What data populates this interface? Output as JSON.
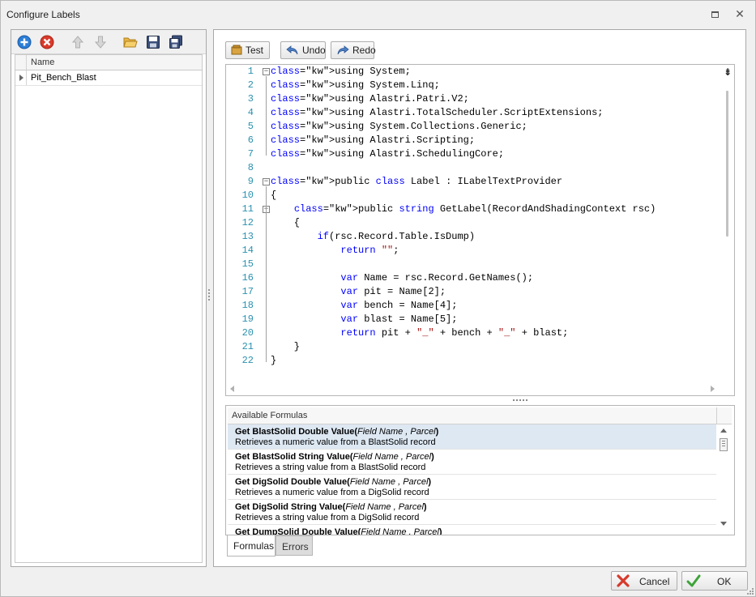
{
  "window": {
    "title": "Configure Labels"
  },
  "left_panel": {
    "toolbar_icons": [
      "add-icon",
      "delete-icon",
      "move-up-icon",
      "move-down-icon",
      "open-folder-icon",
      "save-icon",
      "save-all-icon"
    ],
    "grid": {
      "column_header": "Name",
      "rows": [
        "Pit_Bench_Blast"
      ]
    }
  },
  "editor_toolbar": {
    "test_label": "Test",
    "undo_label": "Undo",
    "redo_label": "Redo"
  },
  "code_lines": [
    {
      "n": "1",
      "text": "using System;"
    },
    {
      "n": "2",
      "text": "using System.Linq;"
    },
    {
      "n": "3",
      "text": "using Alastri.Patri.V2;"
    },
    {
      "n": "4",
      "text": "using Alastri.TotalScheduler.ScriptExtensions;"
    },
    {
      "n": "5",
      "text": "using System.Collections.Generic;"
    },
    {
      "n": "6",
      "text": "using Alastri.Scripting;"
    },
    {
      "n": "7",
      "text": "using Alastri.SchedulingCore;"
    },
    {
      "n": "8",
      "text": ""
    },
    {
      "n": "9",
      "text": "public class Label : ILabelTextProvider"
    },
    {
      "n": "10",
      "text": "{"
    },
    {
      "n": "11",
      "text": "    public string GetLabel(RecordAndShadingContext rsc)"
    },
    {
      "n": "12",
      "text": "    {"
    },
    {
      "n": "13",
      "text": "        if(rsc.Record.Table.IsDump)"
    },
    {
      "n": "14",
      "text": "            return \"\";"
    },
    {
      "n": "15",
      "text": ""
    },
    {
      "n": "16",
      "text": "            var Name = rsc.Record.GetNames();"
    },
    {
      "n": "17",
      "text": "            var pit = Name[2];"
    },
    {
      "n": "18",
      "text": "            var bench = Name[4];"
    },
    {
      "n": "19",
      "text": "            var blast = Name[5];"
    },
    {
      "n": "20",
      "text": "            return pit + \"_\" + bench + \"_\" + blast;"
    },
    {
      "n": "21",
      "text": "    }"
    },
    {
      "n": "22",
      "text": "}"
    }
  ],
  "code_keywords": [
    "using",
    "public",
    "class",
    "string",
    "if",
    "return",
    "var"
  ],
  "formulas": {
    "header": "Available Formulas",
    "items": [
      {
        "name": "Get BlastSolid Double Value",
        "params": "Field Name , Parcel",
        "desc": "Retrieves a numeric value from a BlastSolid record"
      },
      {
        "name": "Get BlastSolid String Value",
        "params": "Field Name , Parcel",
        "desc": "Retrieves a string value from a BlastSolid record"
      },
      {
        "name": "Get DigSolid Double Value",
        "params": "Field Name , Parcel",
        "desc": "Retrieves a numeric value from a DigSolid record"
      },
      {
        "name": "Get DigSolid String Value",
        "params": "Field Name , Parcel",
        "desc": "Retrieves a string value from a DigSolid record"
      },
      {
        "name": "Get DumpSolid Double Value",
        "params": "Field Name , Parcel",
        "desc": ""
      }
    ]
  },
  "tabs": {
    "formulas": "Formulas",
    "errors": "Errors"
  },
  "footer": {
    "cancel_label": "Cancel",
    "ok_label": "OK"
  },
  "colors": {
    "keyword": "#0000ff",
    "string": "#a31515",
    "line_number": "#2b91af",
    "selected_row": "#dde8f3"
  }
}
